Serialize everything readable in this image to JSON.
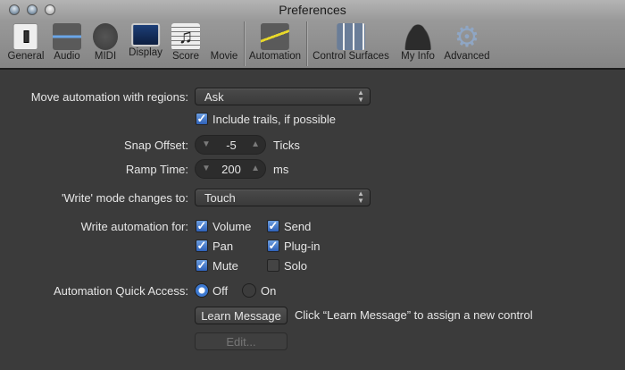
{
  "window": {
    "title": "Preferences"
  },
  "toolbar": [
    {
      "label": "General",
      "icon": "general-switch-icon"
    },
    {
      "label": "Audio",
      "icon": "audio-wave-icon"
    },
    {
      "label": "MIDI",
      "icon": "midi-connector-icon"
    },
    {
      "label": "Display",
      "icon": "display-monitor-icon"
    },
    {
      "label": "Score",
      "icon": "score-notes-icon"
    },
    {
      "label": "Movie",
      "icon": "clapperboard-icon"
    },
    {
      "label": "Automation",
      "icon": "automation-curve-icon"
    },
    {
      "label": "Control Surfaces",
      "icon": "faders-icon"
    },
    {
      "label": "My Info",
      "icon": "person-icon"
    },
    {
      "label": "Advanced",
      "icon": "gear-icon"
    }
  ],
  "form": {
    "move_label": "Move automation with regions:",
    "move_value": "Ask",
    "trails_label": "Include trails, if possible",
    "snap_label": "Snap Offset:",
    "snap_value": "-5",
    "snap_unit": "Ticks",
    "ramp_label": "Ramp Time:",
    "ramp_value": "200",
    "ramp_unit": "ms",
    "write_mode_label": "'Write' mode changes to:",
    "write_mode_value": "Touch",
    "write_for_label": "Write automation for:",
    "volume": "Volume",
    "send": "Send",
    "pan": "Pan",
    "plugin": "Plug-in",
    "mute": "Mute",
    "solo": "Solo",
    "quick_label": "Automation Quick Access:",
    "off": "Off",
    "on": "On",
    "learn_button": "Learn Message",
    "learn_hint": "Click “Learn Message” to assign a new control",
    "edit_button": "Edit..."
  }
}
